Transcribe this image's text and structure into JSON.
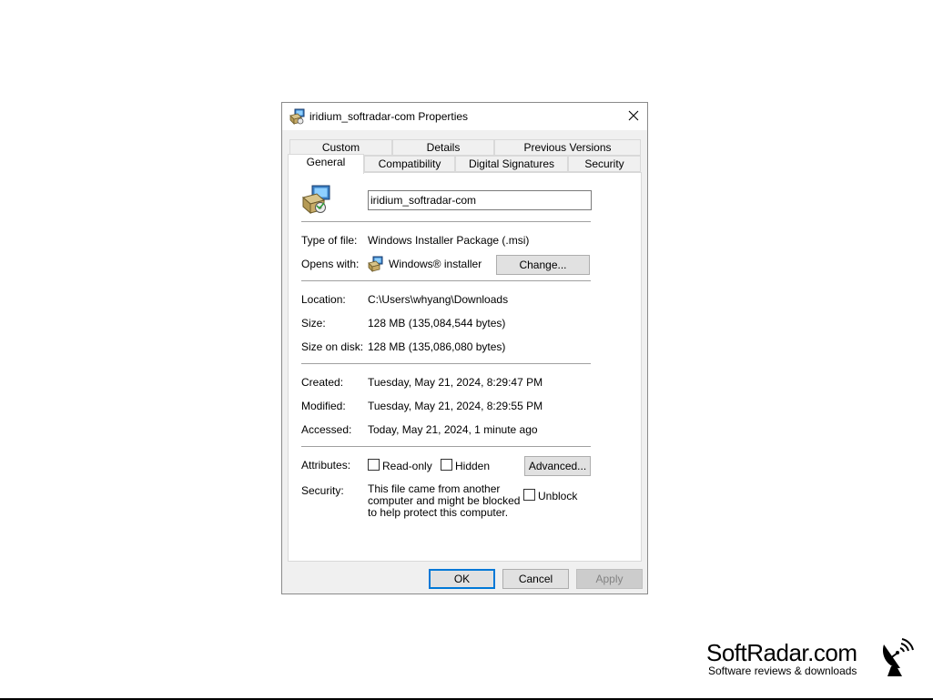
{
  "window": {
    "title": "iridium_softradar-com Properties"
  },
  "tabs": {
    "row1": [
      "Custom",
      "Details",
      "Previous Versions"
    ],
    "row2": [
      "General",
      "Compatibility",
      "Digital Signatures",
      "Security"
    ],
    "active": "General"
  },
  "general": {
    "file_name": "iridium_softradar-com",
    "type_label": "Type of file:",
    "type_value": "Windows Installer Package (.msi)",
    "opens_label": "Opens with:",
    "opens_value": "Windows® installer",
    "change_button": "Change...",
    "location_label": "Location:",
    "location_value": "C:\\Users\\whyang\\Downloads",
    "size_label": "Size:",
    "size_value": "128 MB (135,084,544 bytes)",
    "size_disk_label": "Size on disk:",
    "size_disk_value": "128 MB (135,086,080 bytes)",
    "created_label": "Created:",
    "created_value": "Tuesday, May 21, 2024, 8:29:47 PM",
    "modified_label": "Modified:",
    "modified_value": "Tuesday, May 21, 2024, 8:29:55 PM",
    "accessed_label": "Accessed:",
    "accessed_value": "Today, May 21, 2024, 1 minute ago",
    "attributes_label": "Attributes:",
    "readonly_label": "Read-only",
    "hidden_label": "Hidden",
    "advanced_button": "Advanced...",
    "security_label": "Security:",
    "security_text": "This file came from another computer and might be blocked to help protect this computer.",
    "unblock_label": "Unblock"
  },
  "footer": {
    "ok": "OK",
    "cancel": "Cancel",
    "apply": "Apply"
  },
  "watermark": {
    "brand": "SoftRadar.com",
    "tagline": "Software reviews & downloads"
  },
  "colors": {
    "accent": "#0078d7",
    "dialog_bg": "#f0f0f0"
  }
}
